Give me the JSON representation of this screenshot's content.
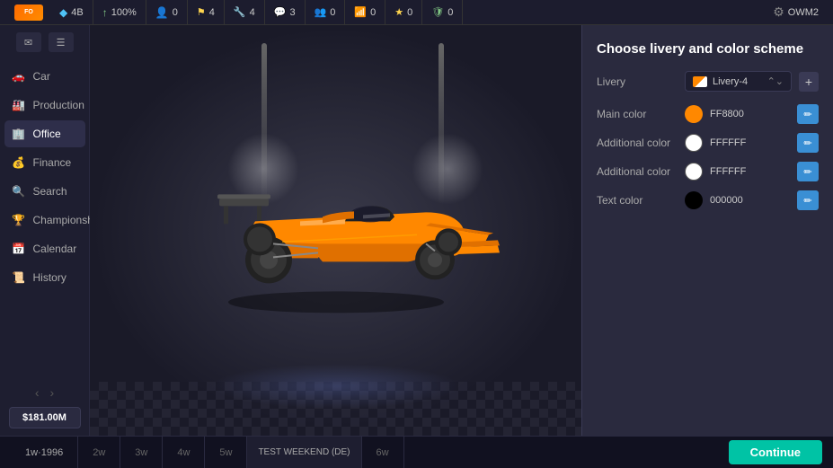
{
  "topbar": {
    "brand": "ForzaOrange",
    "items": [
      {
        "icon": "diamond-icon",
        "value": "4B",
        "color": "blue"
      },
      {
        "icon": "arrow-up-icon",
        "value": "100%",
        "color": "green"
      },
      {
        "icon": "person-icon",
        "value": "0",
        "color": "purple"
      },
      {
        "icon": "flag-icon",
        "value": "4",
        "color": "yellow"
      },
      {
        "icon": "wrench-icon",
        "value": "4",
        "color": "green"
      },
      {
        "icon": "chat-icon",
        "value": "3",
        "color": "orange"
      },
      {
        "icon": "people-icon",
        "value": "0",
        "color": "gray"
      },
      {
        "icon": "signal-icon",
        "value": "0",
        "color": "blue"
      },
      {
        "icon": "star-icon",
        "value": "0",
        "color": "yellow"
      },
      {
        "icon": "shield-icon",
        "value": "0",
        "color": "green"
      }
    ],
    "username": "OWM2",
    "gear_label": "⚙"
  },
  "sidebar": {
    "msg_icons": [
      "✉",
      "☰"
    ],
    "items": [
      {
        "id": "car",
        "label": "Car",
        "icon": "🚗"
      },
      {
        "id": "production",
        "label": "Production",
        "icon": "🏭"
      },
      {
        "id": "office",
        "label": "Office",
        "icon": "🏢",
        "active": true
      },
      {
        "id": "finance",
        "label": "Finance",
        "icon": "💰"
      },
      {
        "id": "search",
        "label": "Search",
        "icon": "🔍"
      },
      {
        "id": "championship",
        "label": "Championship",
        "icon": "🏆"
      },
      {
        "id": "calendar",
        "label": "Calendar",
        "icon": "📅"
      },
      {
        "id": "history",
        "label": "History",
        "icon": "📜"
      }
    ],
    "balance": "$181.00M"
  },
  "panel": {
    "title": "Choose livery and color scheme",
    "livery_label": "Livery",
    "livery_value": "Livery-4",
    "add_btn": "+",
    "colors": [
      {
        "label": "Main color",
        "hex": "FF8800",
        "color": "#FF8800"
      },
      {
        "label": "Additional color",
        "hex": "FFFFFF",
        "color": "#FFFFFF"
      },
      {
        "label": "Additional color",
        "hex": "FFFFFF",
        "color": "#FFFFFF"
      },
      {
        "label": "Text color",
        "hex": "000000",
        "color": "#000000"
      }
    ]
  },
  "timeline": {
    "items": [
      "1w·1996",
      "2w",
      "3w",
      "4w",
      "5w",
      "TEST WEEKEND (DE)",
      "6w"
    ],
    "continue_label": "Continue"
  }
}
